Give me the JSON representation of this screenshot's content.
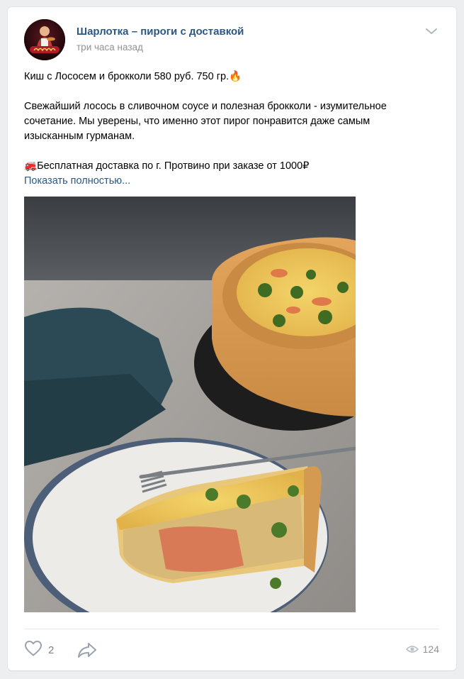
{
  "post": {
    "author": "Шарлотка – пироги с доставкой",
    "time": "три часа назад",
    "title_line": "Киш с Лососем и брокколи 580 руб. 750 гр.",
    "title_emoji": "🔥",
    "body_line1": "Свежайший лосось в сливочном соусе и полезная брокколи - изумительное",
    "body_line2": "сочетание. Мы уверены, что именно этот пирог понравится даже самым",
    "body_line3": "изысканным гурманам.",
    "delivery_emoji": "🚒",
    "delivery_line": "Бесплатная доставка по г. Протвино при заказе от 1000₽",
    "show_more": "Показать полностью..."
  },
  "actions": {
    "likes": "2",
    "views": "124"
  },
  "icons": {
    "menu": "chevron-down-icon",
    "like": "heart-icon",
    "share": "share-arrow-icon",
    "views": "eye-icon"
  },
  "colors": {
    "link": "#2a5885",
    "muted": "#939393",
    "background": "#edeef0"
  }
}
